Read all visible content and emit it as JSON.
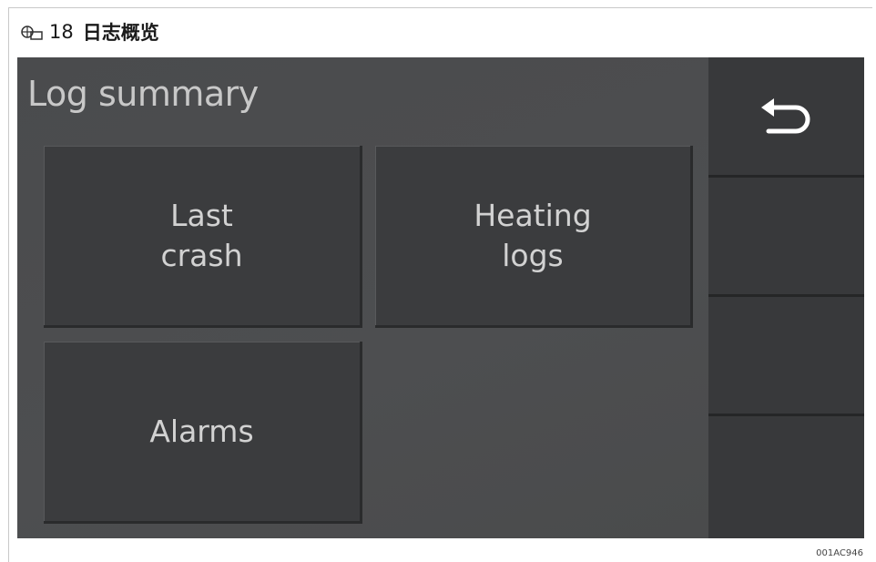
{
  "figure": {
    "number": "18",
    "title": "日志概览",
    "icon": "figure-icon"
  },
  "screen": {
    "title": "Log summary",
    "tiles": [
      {
        "line1": "Last",
        "line2": "crash"
      },
      {
        "line1": "Heating",
        "line2": "logs"
      },
      {
        "line1": "Alarms"
      }
    ],
    "sidebar": {
      "back_icon": "back-arrow-icon"
    }
  },
  "image_code": "001AC946"
}
